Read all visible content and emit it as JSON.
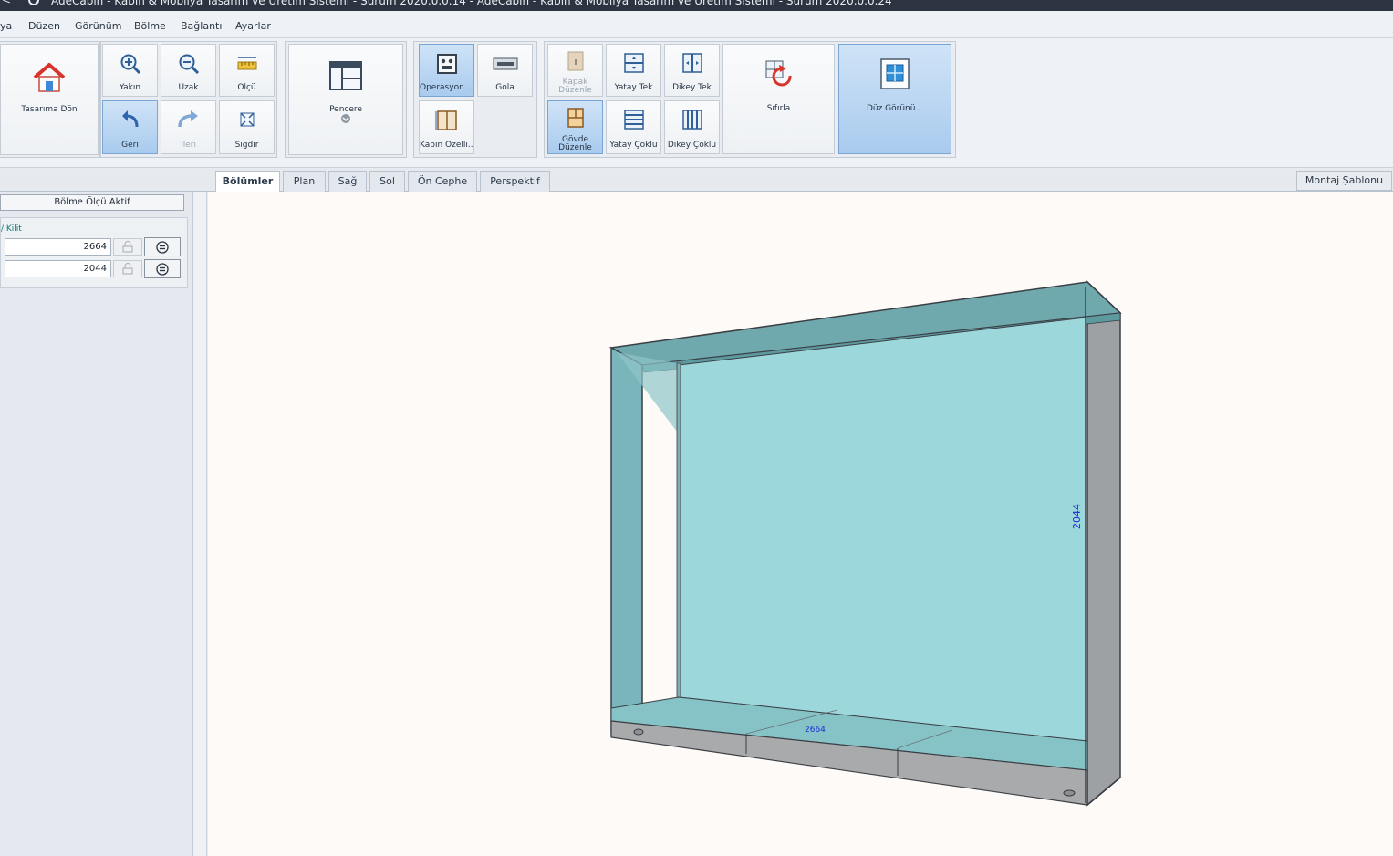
{
  "titlebar": {
    "title": "AdeCabin - Kabin & Mobilya Tasarım ve Üretim Sistemi - Sürüm 2020.0.0.14 - AdeCabin - Kabin & Mobilya Tasarım ve Üretim Sistemi - Sürüm 2020.0.0.24"
  },
  "menu": {
    "items": [
      "ya",
      "Düzen",
      "Görünüm",
      "Bölme",
      "Bağlantı",
      "Ayarlar"
    ]
  },
  "ribbon": {
    "home": "Tasarıma Dön",
    "zoom_in": "Yakın",
    "zoom_out": "Uzak",
    "measure": "Ölçü",
    "undo": "Geri",
    "redo": "İleri",
    "fit": "Sığdır",
    "window": "Pencere",
    "operation": "Operasyon ...",
    "gola": "Gola",
    "cabinet_props": "Kabin Özelli...",
    "door_edit": "Kapak Düzenle",
    "horizontal_single": "Yatay Tek",
    "vertical_single": "Dikey Tek",
    "body_edit": "Gövde Düzenle",
    "horizontal_multi": "Yatay Çoklu",
    "vertical_multi": "Dikey Çoklu",
    "reset": "Sıfırla",
    "flat_view": "Düz Görünü..."
  },
  "tabs": [
    "Bölümler",
    "Plan",
    "Sağ",
    "Sol",
    "Ön Cephe",
    "Perspektif"
  ],
  "active_tab": "Bölümler",
  "montaj_tab": "Montaj Şablonu",
  "left_panel": {
    "active_button": "Bölme Ölçü Aktif",
    "section_title": "/ Kilit",
    "width_value": "2664",
    "height_value": "2044"
  },
  "viewport": {
    "height_dim": "2044",
    "width_dim": "2664"
  }
}
